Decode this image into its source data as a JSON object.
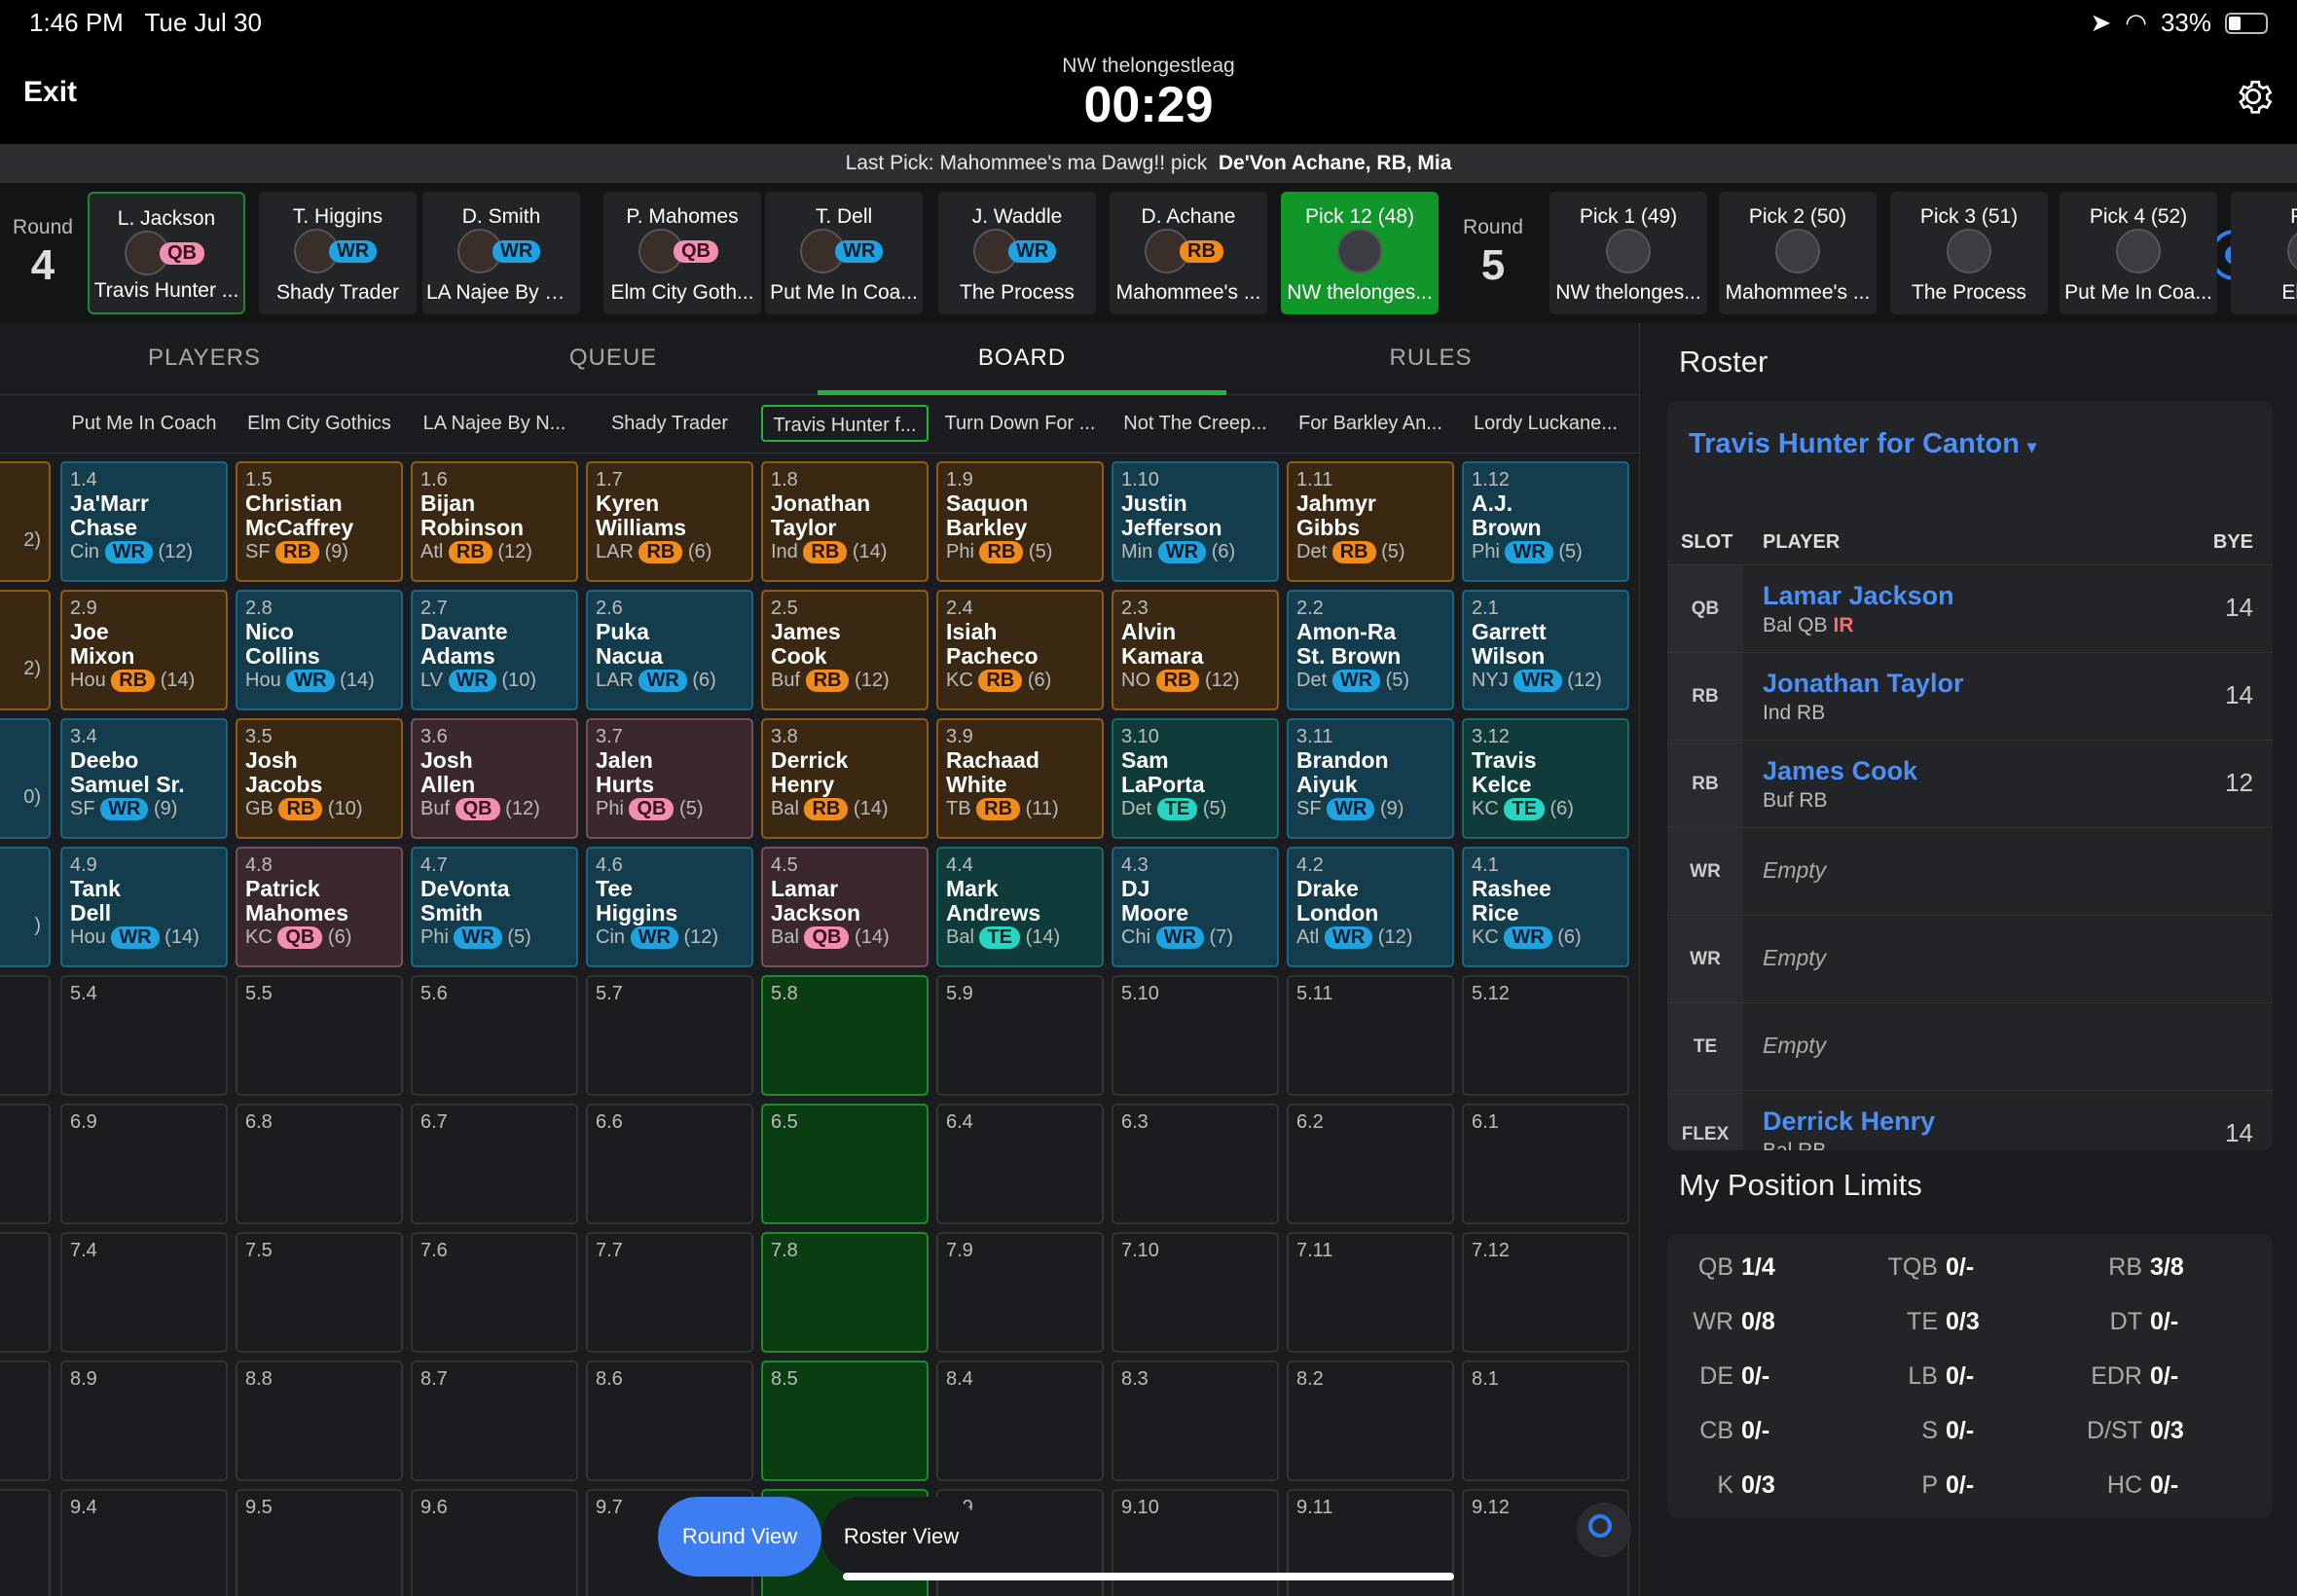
{
  "status": {
    "time": "1:46 PM",
    "date": "Tue Jul 30",
    "battery": "33%"
  },
  "header": {
    "exit": "Exit",
    "league": "NW thelongestleag",
    "timer": "00:29"
  },
  "last_pick": {
    "prefix": "Last Pick: Mahommee's ma Dawg!! pick",
    "player": "De'Von Achane, RB, Mia"
  },
  "strip": {
    "round_label": "Round",
    "round_a": "4",
    "round_b": "5",
    "picks": [
      {
        "name": "L. Jackson",
        "pos": "QB",
        "team": "Travis Hunter ..."
      },
      {
        "name": "T. Higgins",
        "pos": "WR",
        "team": "Shady Trader"
      },
      {
        "name": "D. Smith",
        "pos": "WR",
        "team": "LA Najee By N..."
      },
      {
        "name": "P. Mahomes",
        "pos": "QB",
        "team": "Elm City Goth..."
      },
      {
        "name": "T. Dell",
        "pos": "WR",
        "team": "Put Me In Coa..."
      },
      {
        "name": "J. Waddle",
        "pos": "WR",
        "team": "The Process"
      },
      {
        "name": "D. Achane",
        "pos": "RB",
        "team": "Mahommee's ..."
      },
      {
        "name": "Pick 12 (48)",
        "pos": "",
        "team": "NW thelonges..."
      }
    ],
    "upcoming": [
      {
        "name": "Pick 1 (49)",
        "team": "NW thelonges..."
      },
      {
        "name": "Pick 2 (50)",
        "team": "Mahommee's ..."
      },
      {
        "name": "Pick 3 (51)",
        "team": "The Process"
      },
      {
        "name": "Pick 4 (52)",
        "team": "Put Me In Coa..."
      },
      {
        "name": "Pick",
        "team": "Elm C"
      }
    ]
  },
  "tabs": [
    "PLAYERS",
    "QUEUE",
    "BOARD",
    "RULES"
  ],
  "teams": [
    "ess",
    "Put Me In Coach",
    "Elm City Gothics",
    "LA Najee By N...",
    "Shady Trader",
    "Travis Hunter f...",
    "Turn Down For ...",
    "Not The Creep...",
    "For Barkley An...",
    "Lordy Luckane..."
  ],
  "board": {
    "rows": [
      [
        {
          "pk": "",
          "pos": "RB",
          "first": "",
          "last": "",
          "meta": "2)"
        },
        {
          "pk": "1.4",
          "pos": "WR",
          "first": "Ja'Marr",
          "last": "Chase",
          "team": "Cin",
          "bye": "(12)"
        },
        {
          "pk": "1.5",
          "pos": "RB",
          "first": "Christian",
          "last": "McCaffrey",
          "team": "SF",
          "bye": "(9)"
        },
        {
          "pk": "1.6",
          "pos": "RB",
          "first": "Bijan",
          "last": "Robinson",
          "team": "Atl",
          "bye": "(12)"
        },
        {
          "pk": "1.7",
          "pos": "RB",
          "first": "Kyren",
          "last": "Williams",
          "team": "LAR",
          "bye": "(6)"
        },
        {
          "pk": "1.8",
          "pos": "RB",
          "first": "Jonathan",
          "last": "Taylor",
          "team": "Ind",
          "bye": "(14)"
        },
        {
          "pk": "1.9",
          "pos": "RB",
          "first": "Saquon",
          "last": "Barkley",
          "team": "Phi",
          "bye": "(5)"
        },
        {
          "pk": "1.10",
          "pos": "WR",
          "first": "Justin",
          "last": "Jefferson",
          "team": "Min",
          "bye": "(6)"
        },
        {
          "pk": "1.11",
          "pos": "RB",
          "first": "Jahmyr",
          "last": "Gibbs",
          "team": "Det",
          "bye": "(5)"
        },
        {
          "pk": "1.12",
          "pos": "WR",
          "first": "A.J.",
          "last": "Brown",
          "team": "Phi",
          "bye": "(5)"
        }
      ],
      [
        {
          "pk": "",
          "pos": "RB",
          "first": "",
          "last": "",
          "meta": "2)"
        },
        {
          "pk": "2.9",
          "pos": "RB",
          "first": "Joe",
          "last": "Mixon",
          "team": "Hou",
          "bye": "(14)"
        },
        {
          "pk": "2.8",
          "pos": "WR",
          "first": "Nico",
          "last": "Collins",
          "team": "Hou",
          "bye": "(14)"
        },
        {
          "pk": "2.7",
          "pos": "WR",
          "first": "Davante",
          "last": "Adams",
          "team": "LV",
          "bye": "(10)"
        },
        {
          "pk": "2.6",
          "pos": "WR",
          "first": "Puka",
          "last": "Nacua",
          "team": "LAR",
          "bye": "(6)"
        },
        {
          "pk": "2.5",
          "pos": "RB",
          "first": "James",
          "last": "Cook",
          "team": "Buf",
          "bye": "(12)"
        },
        {
          "pk": "2.4",
          "pos": "RB",
          "first": "Isiah",
          "last": "Pacheco",
          "team": "KC",
          "bye": "(6)"
        },
        {
          "pk": "2.3",
          "pos": "RB",
          "first": "Alvin",
          "last": "Kamara",
          "team": "NO",
          "bye": "(12)"
        },
        {
          "pk": "2.2",
          "pos": "WR",
          "first": "Amon-Ra",
          "last": "St. Brown",
          "team": "Det",
          "bye": "(5)"
        },
        {
          "pk": "2.1",
          "pos": "WR",
          "first": "Garrett",
          "last": "Wilson",
          "team": "NYJ",
          "bye": "(12)"
        }
      ],
      [
        {
          "pk": "",
          "pos": "WR",
          "first": "",
          "last": "",
          "meta": "0)"
        },
        {
          "pk": "3.4",
          "pos": "WR",
          "first": "Deebo",
          "last": "Samuel Sr.",
          "team": "SF",
          "bye": "(9)"
        },
        {
          "pk": "3.5",
          "pos": "RB",
          "first": "Josh",
          "last": "Jacobs",
          "team": "GB",
          "bye": "(10)"
        },
        {
          "pk": "3.6",
          "pos": "QB",
          "first": "Josh",
          "last": "Allen",
          "team": "Buf",
          "bye": "(12)"
        },
        {
          "pk": "3.7",
          "pos": "QB",
          "first": "Jalen",
          "last": "Hurts",
          "team": "Phi",
          "bye": "(5)"
        },
        {
          "pk": "3.8",
          "pos": "RB",
          "first": "Derrick",
          "last": "Henry",
          "team": "Bal",
          "bye": "(14)"
        },
        {
          "pk": "3.9",
          "pos": "RB",
          "first": "Rachaad",
          "last": "White",
          "team": "TB",
          "bye": "(11)"
        },
        {
          "pk": "3.10",
          "pos": "TE",
          "first": "Sam",
          "last": "LaPorta",
          "team": "Det",
          "bye": "(5)"
        },
        {
          "pk": "3.11",
          "pos": "WR",
          "first": "Brandon",
          "last": "Aiyuk",
          "team": "SF",
          "bye": "(9)"
        },
        {
          "pk": "3.12",
          "pos": "TE",
          "first": "Travis",
          "last": "Kelce",
          "team": "KC",
          "bye": "(6)"
        }
      ],
      [
        {
          "pk": "",
          "pos": "WR",
          "first": "",
          "last": "",
          "meta": ")"
        },
        {
          "pk": "4.9",
          "pos": "WR",
          "first": "Tank",
          "last": "Dell",
          "team": "Hou",
          "bye": "(14)"
        },
        {
          "pk": "4.8",
          "pos": "QB",
          "first": "Patrick",
          "last": "Mahomes",
          "team": "KC",
          "bye": "(6)"
        },
        {
          "pk": "4.7",
          "pos": "WR",
          "first": "DeVonta",
          "last": "Smith",
          "team": "Phi",
          "bye": "(5)"
        },
        {
          "pk": "4.6",
          "pos": "WR",
          "first": "Tee",
          "last": "Higgins",
          "team": "Cin",
          "bye": "(12)"
        },
        {
          "pk": "4.5",
          "pos": "QB",
          "first": "Lamar",
          "last": "Jackson",
          "team": "Bal",
          "bye": "(14)"
        },
        {
          "pk": "4.4",
          "pos": "TE",
          "first": "Mark",
          "last": "Andrews",
          "team": "Bal",
          "bye": "(14)"
        },
        {
          "pk": "4.3",
          "pos": "WR",
          "first": "DJ",
          "last": "Moore",
          "team": "Chi",
          "bye": "(7)"
        },
        {
          "pk": "4.2",
          "pos": "WR",
          "first": "Drake",
          "last": "London",
          "team": "Atl",
          "bye": "(12)"
        },
        {
          "pk": "4.1",
          "pos": "WR",
          "first": "Rashee",
          "last": "Rice",
          "team": "KC",
          "bye": "(6)"
        }
      ],
      [
        "",
        "5.4",
        "5.5",
        "5.6",
        "5.7",
        "5.8",
        "5.9",
        "5.10",
        "5.11",
        "5.12"
      ],
      [
        "",
        "6.9",
        "6.8",
        "6.7",
        "6.6",
        "6.5",
        "6.4",
        "6.3",
        "6.2",
        "6.1"
      ],
      [
        "",
        "7.4",
        "7.5",
        "7.6",
        "7.7",
        "7.8",
        "7.9",
        "7.10",
        "7.11",
        "7.12"
      ],
      [
        "",
        "8.9",
        "8.8",
        "8.7",
        "8.6",
        "8.5",
        "8.4",
        "8.3",
        "8.2",
        "8.1"
      ],
      [
        "",
        "9.4",
        "9.5",
        "9.6",
        "9.7",
        "",
        "9.9",
        "9.10",
        "9.11",
        "9.12"
      ]
    ]
  },
  "view_toggle": {
    "round": "Round View",
    "roster": "Roster View"
  },
  "roster": {
    "title": "Roster",
    "team": "Travis Hunter for Canton",
    "cols": {
      "slot": "SLOT",
      "player": "PLAYER",
      "bye": "BYE"
    },
    "rows": [
      {
        "slot": "QB",
        "name": "Lamar Jackson",
        "meta": "Bal QB",
        "ir": "IR",
        "bye": "14"
      },
      {
        "slot": "RB",
        "name": "Jonathan Taylor",
        "meta": "Ind RB",
        "bye": "14"
      },
      {
        "slot": "RB",
        "name": "James Cook",
        "meta": "Buf RB",
        "bye": "12"
      },
      {
        "slot": "WR",
        "empty": "Empty"
      },
      {
        "slot": "WR",
        "empty": "Empty"
      },
      {
        "slot": "TE",
        "empty": "Empty"
      },
      {
        "slot": "FLEX",
        "name": "Derrick Henry",
        "meta": "Bal RB",
        "bye": "14"
      }
    ]
  },
  "limits": {
    "title": "My Position Limits",
    "items": [
      [
        "QB",
        "1/4"
      ],
      [
        "TQB",
        "0/-"
      ],
      [
        "RB",
        "3/8"
      ],
      [
        "WR",
        "0/8"
      ],
      [
        "TE",
        "0/3"
      ],
      [
        "DT",
        "0/-"
      ],
      [
        "DE",
        "0/-"
      ],
      [
        "LB",
        "0/-"
      ],
      [
        "EDR",
        "0/-"
      ],
      [
        "CB",
        "0/-"
      ],
      [
        "S",
        "0/-"
      ],
      [
        "D/ST",
        "0/3"
      ],
      [
        "K",
        "0/3"
      ],
      [
        "P",
        "0/-"
      ],
      [
        "HC",
        "0/-"
      ]
    ]
  }
}
